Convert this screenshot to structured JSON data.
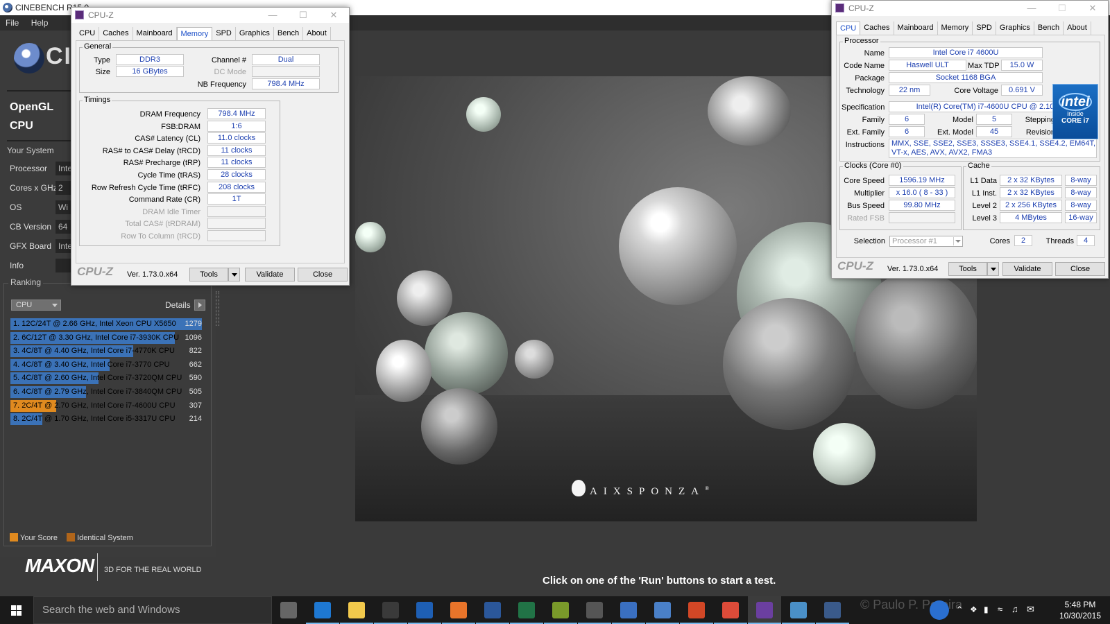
{
  "cinebench": {
    "title": "CINEBENCH R15.0",
    "menu": [
      "File",
      "Help"
    ],
    "logo_text": "CI",
    "engines": [
      "OpenGL",
      "CPU"
    ],
    "your_system_title": "Your System",
    "system_rows": [
      {
        "label": "Processor",
        "value": "Inte"
      },
      {
        "label": "Cores x GHz",
        "value": "2 C"
      },
      {
        "label": "OS",
        "value": "Wi"
      },
      {
        "label": "CB Version",
        "value": "64"
      },
      {
        "label": "GFX Board",
        "value": "Inte"
      },
      {
        "label": "Info",
        "value": ""
      }
    ],
    "ranking": {
      "title": "Ranking",
      "dropdown": "CPU",
      "details_label": "Details",
      "max_score": 1279,
      "rows": [
        {
          "label": "1. 12C/24T @ 2.66 GHz, Intel Xeon CPU X5650",
          "score": 1279,
          "me": false
        },
        {
          "label": "2. 6C/12T @ 3.30 GHz,  Intel Core i7-3930K CPU",
          "score": 1096,
          "me": false
        },
        {
          "label": "3. 4C/8T @ 4.40 GHz, Intel Core i7-4770K CPU",
          "score": 822,
          "me": false
        },
        {
          "label": "4. 4C/8T @ 3.40 GHz,  Intel Core i7-3770 CPU",
          "score": 662,
          "me": false
        },
        {
          "label": "5. 4C/8T @ 2.60 GHz, Intel Core i7-3720QM CPU",
          "score": 590,
          "me": false
        },
        {
          "label": "6. 4C/8T @ 2.79 GHz,  Intel Core i7-3840QM CPU",
          "score": 505,
          "me": false
        },
        {
          "label": "7. 2C/4T @ 2.70 GHz, Intel Core i7-4600U CPU",
          "score": 307,
          "me": true
        },
        {
          "label": "8. 2C/4T @ 1.70 GHz,  Intel Core i5-3317U CPU",
          "score": 214,
          "me": false
        }
      ],
      "legend": [
        {
          "label": "Your Score",
          "color": "#e08a1f"
        },
        {
          "label": "Identical System",
          "color": "#b0651a"
        }
      ]
    },
    "maxon": "MAXON",
    "maxon_tagline": "3D FOR THE REAL WORLD",
    "render_brand": "AIXSPONZA",
    "render_brand_reg": "®",
    "status": "Click on one of the 'Run' buttons to start a test."
  },
  "cpuz_memory": {
    "title": "CPU-Z",
    "tabs": [
      "CPU",
      "Caches",
      "Mainboard",
      "Memory",
      "SPD",
      "Graphics",
      "Bench",
      "About"
    ],
    "active_tab": "Memory",
    "general": {
      "title": "General",
      "type_label": "Type",
      "type": "DDR3",
      "size_label": "Size",
      "size": "16 GBytes",
      "channel_label": "Channel #",
      "channel": "Dual",
      "dc_label": "DC Mode",
      "dc": "",
      "nb_label": "NB Frequency",
      "nb": "798.4 MHz"
    },
    "timings": {
      "title": "Timings",
      "rows": [
        {
          "label": "DRAM Frequency",
          "value": "798.4 MHz",
          "dim": false
        },
        {
          "label": "FSB:DRAM",
          "value": "1:6",
          "dim": false
        },
        {
          "label": "CAS# Latency (CL)",
          "value": "11.0 clocks",
          "dim": false
        },
        {
          "label": "RAS# to CAS# Delay (tRCD)",
          "value": "11 clocks",
          "dim": false
        },
        {
          "label": "RAS# Precharge (tRP)",
          "value": "11 clocks",
          "dim": false
        },
        {
          "label": "Cycle Time (tRAS)",
          "value": "28 clocks",
          "dim": false
        },
        {
          "label": "Row Refresh Cycle Time (tRFC)",
          "value": "208 clocks",
          "dim": false
        },
        {
          "label": "Command Rate (CR)",
          "value": "1T",
          "dim": false
        },
        {
          "label": "DRAM Idle Timer",
          "value": "",
          "dim": true
        },
        {
          "label": "Total CAS# (tRDRAM)",
          "value": "",
          "dim": true
        },
        {
          "label": "Row To Column (tRCD)",
          "value": "",
          "dim": true
        }
      ]
    },
    "footer": {
      "logo": "CPU-Z",
      "version": "Ver. 1.73.0.x64",
      "tools": "Tools",
      "validate": "Validate",
      "close": "Close"
    }
  },
  "cpuz_cpu": {
    "title": "CPU-Z",
    "tabs": [
      "CPU",
      "Caches",
      "Mainboard",
      "Memory",
      "SPD",
      "Graphics",
      "Bench",
      "About"
    ],
    "active_tab": "CPU",
    "processor": {
      "title": "Processor",
      "name_label": "Name",
      "name": "Intel Core i7 4600U",
      "codename_label": "Code Name",
      "codename": "Haswell ULT",
      "maxtdp_label": "Max TDP",
      "maxtdp": "15.0 W",
      "package_label": "Package",
      "package": "Socket 1168 BGA",
      "tech_label": "Technology",
      "tech": "22 nm",
      "voltage_label": "Core Voltage",
      "voltage": "0.691 V",
      "spec_label": "Specification",
      "spec": "Intel(R) Core(TM) i7-4600U CPU @ 2.10GHz",
      "family_label": "Family",
      "family": "6",
      "model_label": "Model",
      "model": "5",
      "stepping_label": "Stepping",
      "stepping": "1",
      "extfamily_label": "Ext. Family",
      "extfamily": "6",
      "extmodel_label": "Ext. Model",
      "extmodel": "45",
      "revision_label": "Revision",
      "revision": "C0",
      "instr_label": "Instructions",
      "instr": "MMX, SSE, SSE2, SSE3, SSSE3, SSE4.1, SSE4.2, EM64T, VT-x, AES, AVX, AVX2, FMA3"
    },
    "intel_badge": {
      "brand": "intel",
      "line2": "inside",
      "line3": "CORE i7"
    },
    "clocks": {
      "title": "Clocks (Core #0)",
      "core_speed_label": "Core Speed",
      "core_speed": "1596.19 MHz",
      "multiplier_label": "Multiplier",
      "multiplier": "x 16.0 ( 8 - 33 )",
      "bus_label": "Bus Speed",
      "bus": "99.80 MHz",
      "fsb_label": "Rated FSB",
      "fsb": ""
    },
    "cache": {
      "title": "Cache",
      "rows": [
        {
          "label": "L1 Data",
          "size": "2 x 32 KBytes",
          "way": "8-way"
        },
        {
          "label": "L1 Inst.",
          "size": "2 x 32 KBytes",
          "way": "8-way"
        },
        {
          "label": "Level 2",
          "size": "2 x 256 KBytes",
          "way": "8-way"
        },
        {
          "label": "Level 3",
          "size": "4 MBytes",
          "way": "16-way"
        }
      ]
    },
    "selection_label": "Selection",
    "selection": "Processor #1",
    "cores_label": "Cores",
    "cores": "2",
    "threads_label": "Threads",
    "threads": "4",
    "footer": {
      "logo": "CPU-Z",
      "version": "Ver. 1.73.0.x64",
      "tools": "Tools",
      "validate": "Validate",
      "close": "Close"
    }
  },
  "taskbar": {
    "search_placeholder": "Search the web and Windows",
    "watermark": "© Paulo P. Pereira",
    "time": "5:48 PM",
    "date": "10/30/2015",
    "icons": [
      "task-view-icon",
      "edge-icon",
      "file-explorer-icon",
      "store-icon",
      "outlook-icon",
      "firefox-icon",
      "word-icon",
      "excel-icon",
      "publisher-icon",
      "calculator-icon",
      "remote-desktop-icon",
      "network-icon",
      "powerpoint-icon",
      "chrome-icon",
      "cpuz-taskbar-icon",
      "notepad-icon",
      "cinebench-taskbar-icon"
    ]
  }
}
